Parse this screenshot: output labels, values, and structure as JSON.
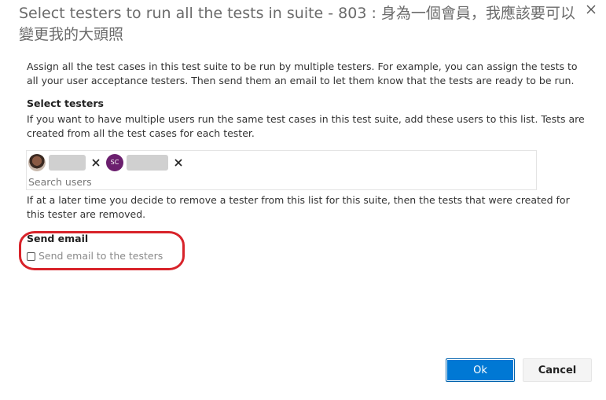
{
  "dialog": {
    "title": "Select testers to run all the tests in suite - 803 : 身為一個會員，我應該要可以變更我的大頭照",
    "close_icon": "close-icon"
  },
  "intro": {
    "text": "Assign all the test cases in this test suite to be run by multiple testers. For example, you can assign the tests to all your user acceptance testers. Then send them an email to let them know that the tests are ready to be run."
  },
  "select_testers": {
    "label": "Select testers",
    "help": "If you want to have multiple users run the same test cases in this test suite, add these users to this list. Tests are created from all the test cases for each tester.",
    "chips": [
      {
        "avatar": "user-photo-avatar",
        "remove_icon": "close-icon"
      },
      {
        "avatar_initials": "SC",
        "avatar_color": "#6b1f6e",
        "remove_icon": "close-icon"
      }
    ],
    "search_placeholder": "Search users",
    "remove_note": "If at a later time you decide to remove a tester from this list for this suite, then the tests that were created for this tester are removed."
  },
  "send_email": {
    "label": "Send email",
    "checkbox_label": "Send email to the testers",
    "checked": false,
    "highlight_color": "#d8232a"
  },
  "footer": {
    "ok_label": "Ok",
    "cancel_label": "Cancel",
    "primary_color": "#0078d4"
  }
}
